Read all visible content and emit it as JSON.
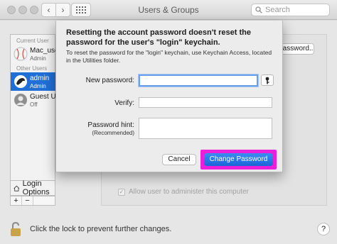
{
  "window": {
    "title": "Users & Groups",
    "search_placeholder": "Search"
  },
  "sidebar": {
    "current_user_header": "Current User",
    "other_users_header": "Other Users",
    "users": [
      {
        "name": "Mac_user",
        "role": "Admin"
      },
      {
        "name": "admin",
        "role": "Admin"
      },
      {
        "name": "Guest User",
        "role": "Off"
      }
    ],
    "login_options_label": "Login Options",
    "add_label": "+",
    "remove_label": "−"
  },
  "main": {
    "password_button_label": "Password...",
    "allow_admin_label": "Allow user to administer this computer",
    "lock_text": "Click the lock to prevent further changes.",
    "help_label": "?"
  },
  "dialog": {
    "title": "Resetting the account password doesn't reset the password for the user's \"login\" keychain.",
    "description": "To reset the password for the \"login\" keychain, use Keychain Access, located in the Utilities folder.",
    "new_password_label": "New password:",
    "verify_label": "Verify:",
    "hint_label": "Password hint:",
    "hint_sublabel": "(Recommended)",
    "new_password_value": "",
    "verify_value": "",
    "hint_value": "",
    "cancel_label": "Cancel",
    "change_label": "Change Password"
  },
  "colors": {
    "selection": "#1f6fd6",
    "primary_button": "#1a66d8",
    "highlight_border": "#e91fd9"
  }
}
